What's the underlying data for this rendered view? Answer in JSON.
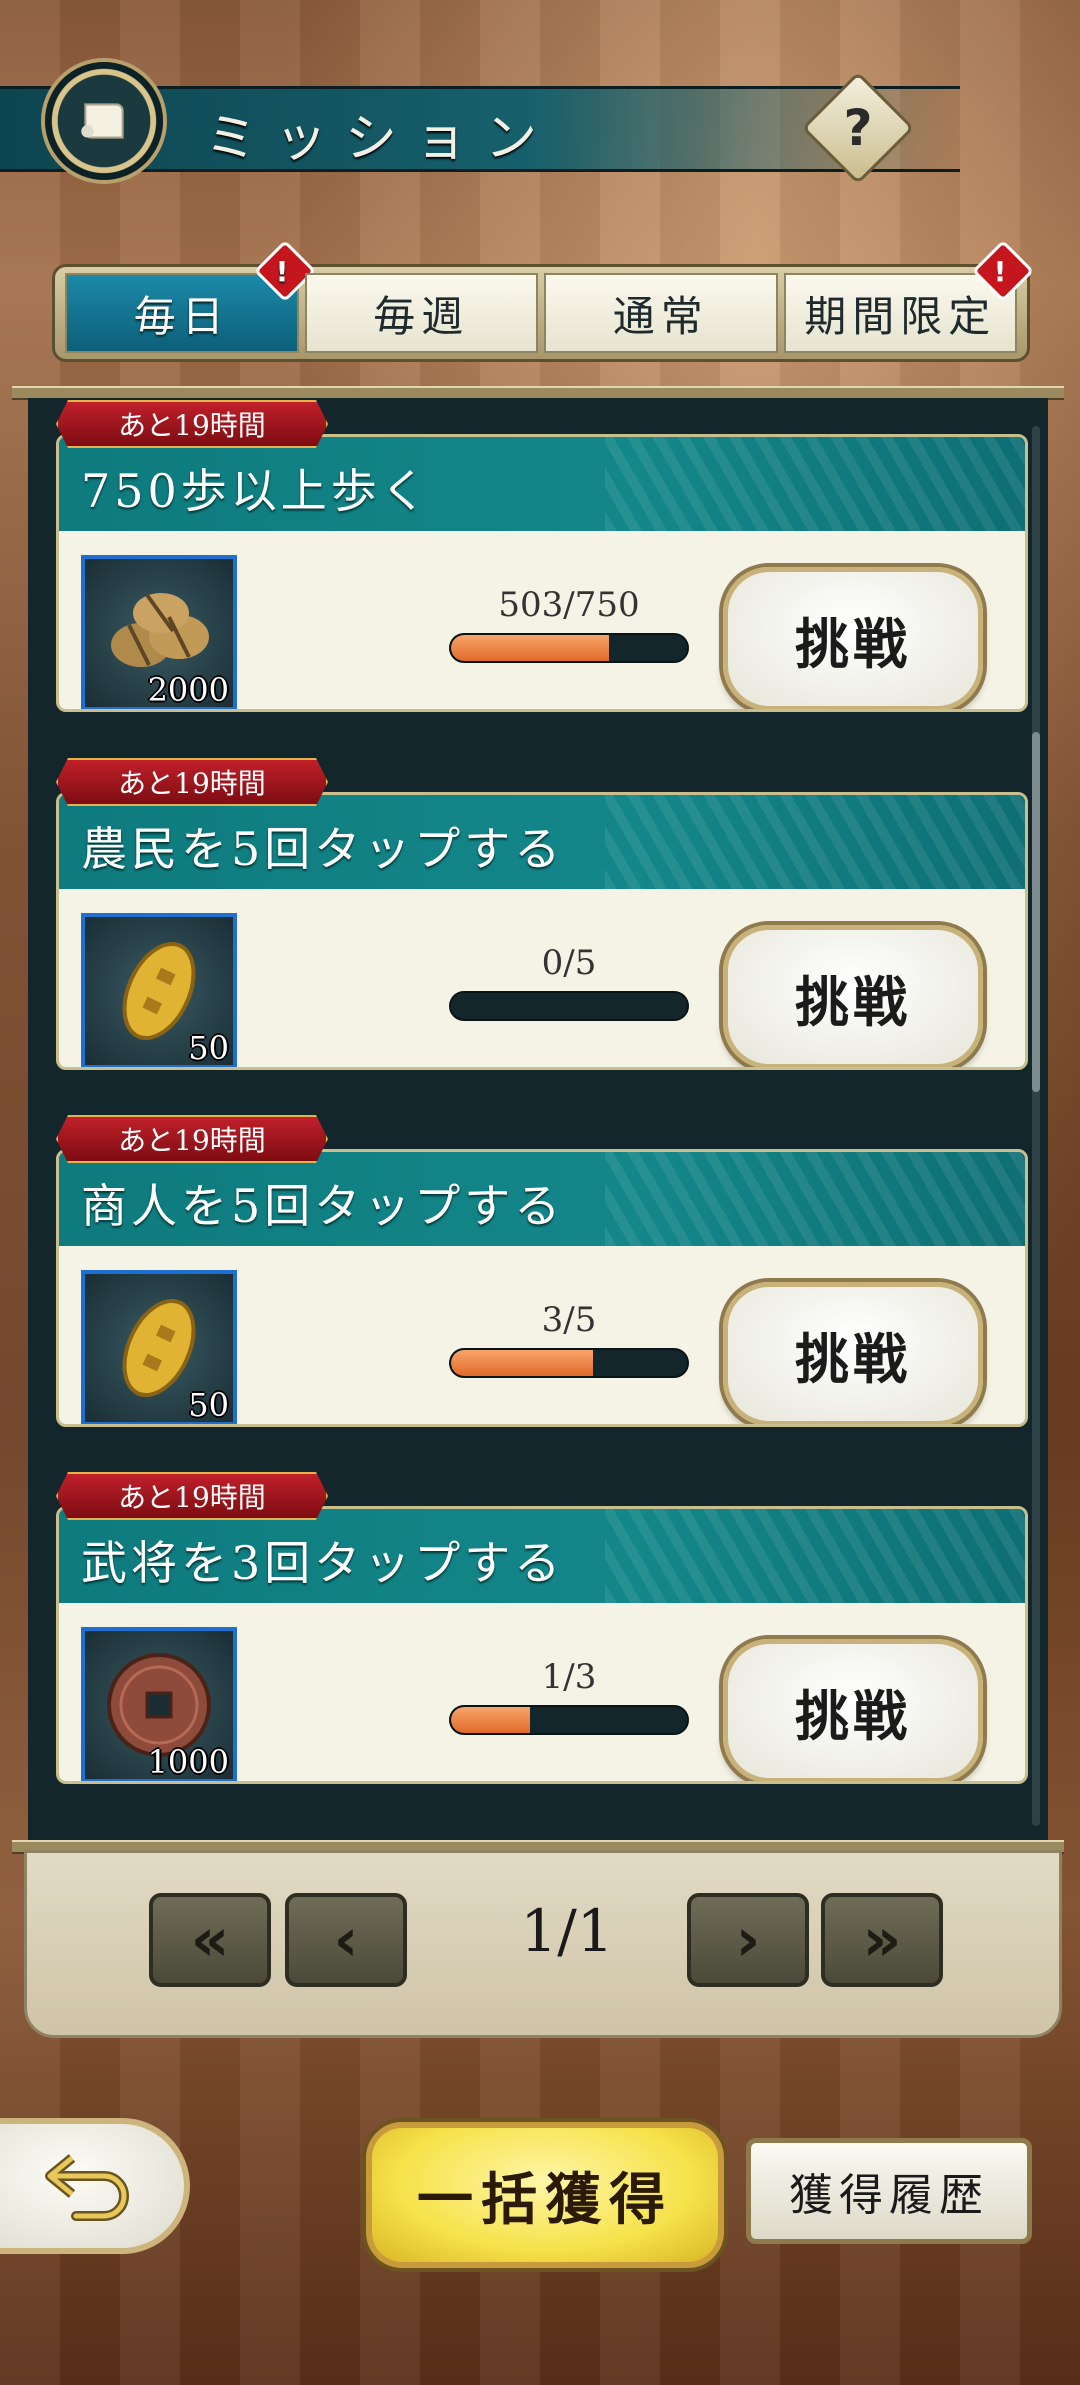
{
  "header": {
    "title": "ミッション",
    "help_label": "?"
  },
  "tabs": [
    {
      "label": "毎日",
      "active": true,
      "alert": true
    },
    {
      "label": "毎週",
      "active": false,
      "alert": false
    },
    {
      "label": "通常",
      "active": false,
      "alert": false
    },
    {
      "label": "期間限定",
      "active": false,
      "alert": true
    }
  ],
  "alert_symbol": "!",
  "missions": [
    {
      "time_left": "あと19時間",
      "title": "750歩以上歩く",
      "reward_icon": "rice-bale-icon",
      "reward_count": "2000",
      "progress_text": "503/750",
      "progress": 0.67,
      "button_label": "挑戦"
    },
    {
      "time_left": "あと19時間",
      "title": "農民を5回タップする",
      "reward_icon": "gold-koban-icon",
      "reward_count": "50",
      "progress_text": "0/5",
      "progress": 0.0,
      "button_label": "挑戦"
    },
    {
      "time_left": "あと19時間",
      "title": "商人を5回タップする",
      "reward_icon": "gold-koban-icon",
      "reward_count": "50",
      "progress_text": "3/5",
      "progress": 0.6,
      "button_label": "挑戦"
    },
    {
      "time_left": "あと19時間",
      "title": "武将を3回タップする",
      "reward_icon": "copper-coin-icon",
      "reward_count": "1000",
      "progress_text": "1/3",
      "progress": 0.333,
      "button_label": "挑戦"
    }
  ],
  "pager": {
    "first": "«",
    "prev": "‹",
    "page": "1/1",
    "next": "›",
    "last": "»"
  },
  "bottom": {
    "collect_all": "一括獲得",
    "history": "獲得履歴",
    "back_icon": "back-arrow-icon"
  },
  "colors": {
    "accent_teal": "#0f7a7d",
    "progress": "#e06a2a",
    "time_badge": "#c0202a",
    "alert": "#c4161c"
  }
}
